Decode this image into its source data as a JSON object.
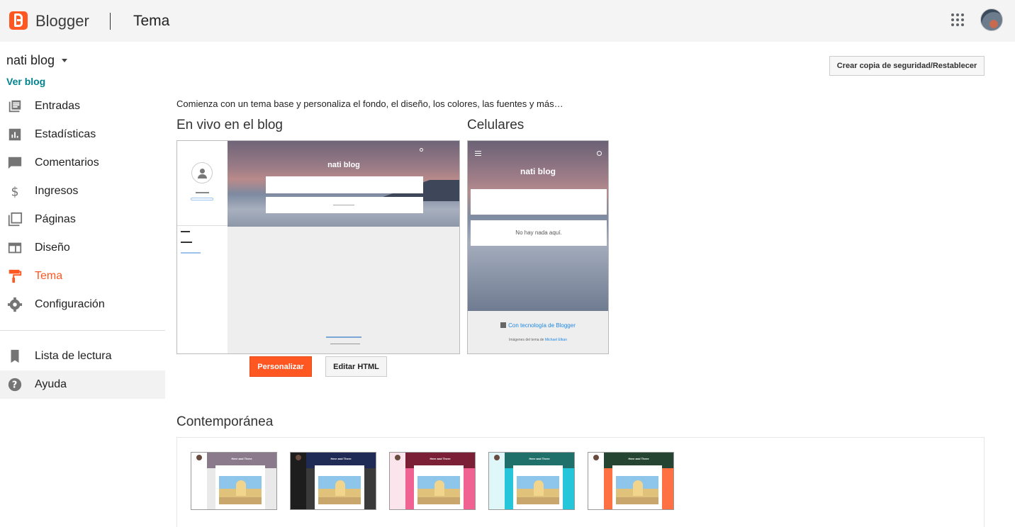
{
  "header": {
    "brand": "Blogger",
    "page": "Tema"
  },
  "sidebar": {
    "blog_name": "nati blog",
    "view_blog": "Ver blog",
    "items": [
      {
        "label": "Entradas",
        "icon": "posts-icon"
      },
      {
        "label": "Estadísticas",
        "icon": "stats-icon"
      },
      {
        "label": "Comentarios",
        "icon": "comments-icon"
      },
      {
        "label": "Ingresos",
        "icon": "dollar-icon"
      },
      {
        "label": "Páginas",
        "icon": "pages-icon"
      },
      {
        "label": "Diseño",
        "icon": "layout-icon"
      },
      {
        "label": "Tema",
        "icon": "paint-roller-icon",
        "active": true
      },
      {
        "label": "Configuración",
        "icon": "gear-icon"
      }
    ],
    "secondary": [
      {
        "label": "Lista de lectura",
        "icon": "bookmark-icon"
      },
      {
        "label": "Ayuda",
        "icon": "help-icon"
      }
    ]
  },
  "main": {
    "backup_button": "Crear copia de seguridad/Restablecer",
    "intro": "Comienza con un tema base y personaliza el fondo, el diseño, los colores, las fuentes y más…",
    "live_title": "En vivo en el blog",
    "mobile_title": "Celulares",
    "desktop_preview": {
      "blog_title": "nati blog"
    },
    "mobile_preview": {
      "blog_title": "nati blog",
      "empty_text": "No hay nada aquí.",
      "powered_by": "Con tecnología de Blogger",
      "credit_prefix": "Imágenes del tema de",
      "credit_author": "Michael Elkan"
    },
    "customize_button": "Personalizar",
    "edit_html_button": "Editar HTML",
    "gallery_title": "Contemporánea",
    "themes": [
      {
        "hero": "#8a7a8c",
        "body": "#e9e9e9",
        "title": "Here and There"
      },
      {
        "hero": "#1f2b55",
        "body": "#3a3a3a",
        "title": "Here and There"
      },
      {
        "hero": "#7a1f36",
        "body": "#f06292",
        "title": "Here and There"
      },
      {
        "hero": "#1f6f6a",
        "body": "#26c6da",
        "title": "Here and There"
      },
      {
        "hero": "#254432",
        "body": "#ff7043",
        "title": "Here and There"
      }
    ]
  },
  "colors": {
    "accent": "#ff5722",
    "link": "#00838f"
  }
}
